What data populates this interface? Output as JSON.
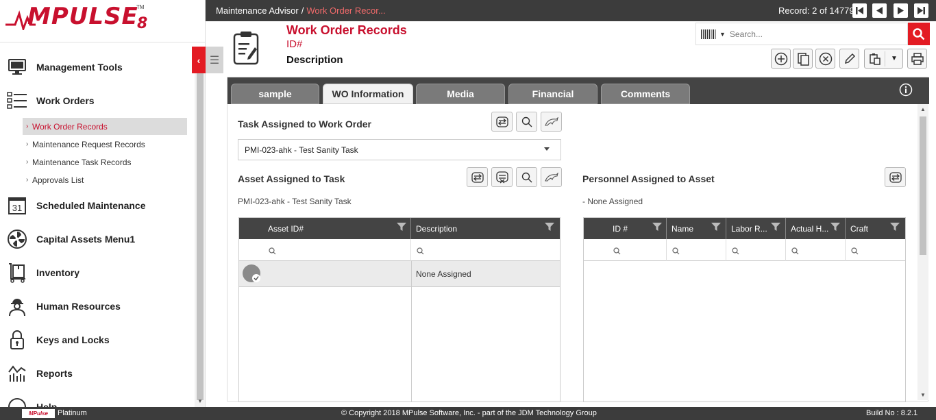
{
  "app": {
    "logo_text": "MPULSE",
    "logo_suffix": "8",
    "logo_tm": "TM"
  },
  "sidebar": {
    "items": [
      {
        "label": "Management Tools",
        "icon": "monitor-icon"
      },
      {
        "label": "Work Orders",
        "icon": "list-icon"
      },
      {
        "label": "Scheduled Maintenance",
        "icon": "calendar-icon"
      },
      {
        "label": "Capital Assets Menu1",
        "icon": "fan-icon"
      },
      {
        "label": "Inventory",
        "icon": "dolly-icon"
      },
      {
        "label": "Human Resources",
        "icon": "worker-icon"
      },
      {
        "label": "Keys and Locks",
        "icon": "lock-icon"
      },
      {
        "label": "Reports",
        "icon": "chart-icon"
      },
      {
        "label": "Help",
        "icon": "help-icon"
      }
    ],
    "sub_items": [
      {
        "label": "Work Order Records",
        "active": true
      },
      {
        "label": "Maintenance Request Records",
        "active": false
      },
      {
        "label": "Maintenance Task Records",
        "active": false
      },
      {
        "label": "Approvals List",
        "active": false
      }
    ],
    "calendar_day": "31"
  },
  "topbar": {
    "breadcrumb_root": "Maintenance Advisor",
    "breadcrumb_sep": "/",
    "breadcrumb_current": "Work Order Recor...",
    "record_text": "Record: 2 of 14779"
  },
  "header": {
    "title": "Work Order Records",
    "id_label": "ID#",
    "description": "Description",
    "search_placeholder": "Search..."
  },
  "tabs": [
    {
      "label": "sample",
      "active": false
    },
    {
      "label": "WO Information",
      "active": true
    },
    {
      "label": "Media",
      "active": false
    },
    {
      "label": "Financial",
      "active": false
    },
    {
      "label": "Comments",
      "active": false
    }
  ],
  "task_section": {
    "title": "Task Assigned to Work Order",
    "selected": "PMI-023-ahk - Test Sanity Task"
  },
  "asset_section": {
    "title": "Asset Assigned to Task",
    "subtitle": "PMI-023-ahk - Test Sanity Task",
    "columns": [
      "Asset ID#",
      "Description"
    ],
    "rows": [
      {
        "asset_id": "",
        "description": "None Assigned"
      }
    ]
  },
  "personnel_section": {
    "title": "Personnel Assigned to Asset",
    "subtitle": "- None Assigned",
    "columns": [
      "ID #",
      "Name",
      "Labor R...",
      "Actual H...",
      "Craft"
    ]
  },
  "footer": {
    "logo_text": "MPulse",
    "edition": "Platinum",
    "copyright": "© Copyright 2018 MPulse Software, Inc. - part of the JDM Technology Group",
    "build": "Build No : 8.2.1"
  },
  "colors": {
    "brand_red": "#c8102e",
    "accent_red": "#e31b23",
    "dark_bar": "#3c3c3c"
  }
}
